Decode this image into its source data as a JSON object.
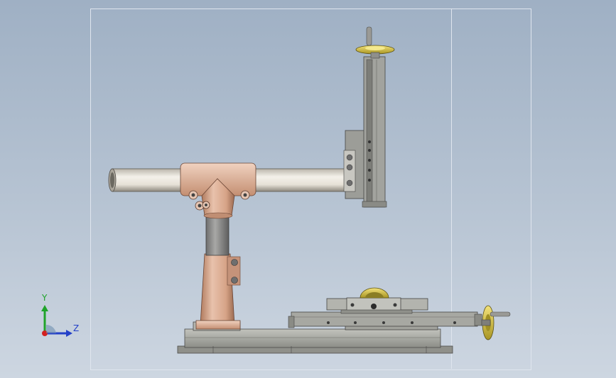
{
  "viewport": {
    "title": "",
    "background_top": "#9fb0c4",
    "background_bottom": "#cdd6e1",
    "frame_color": "#dfe5ee"
  },
  "model": {
    "components": [
      {
        "name": "horizontal-tube",
        "color": "#e3dfd6"
      },
      {
        "name": "tee-clamp",
        "color": "#dfb9a2"
      },
      {
        "name": "column-upper",
        "color": "#8a8a8a"
      },
      {
        "name": "column-sleeve",
        "color": "#d7a68b"
      },
      {
        "name": "base-plate",
        "color": "#a8aaa4"
      },
      {
        "name": "vertical-slide",
        "color": "#8f8f8b"
      },
      {
        "name": "handwheel-top",
        "color": "#d4c23e"
      },
      {
        "name": "horizontal-slide",
        "color": "#9a9b95"
      },
      {
        "name": "handwheel-side",
        "color": "#d8c53a"
      }
    ]
  },
  "triad": {
    "y_label": "Y",
    "z_label": "Z",
    "y_color": "#1fa32a",
    "z_color": "#2340c8",
    "x_color": "#d22020"
  }
}
